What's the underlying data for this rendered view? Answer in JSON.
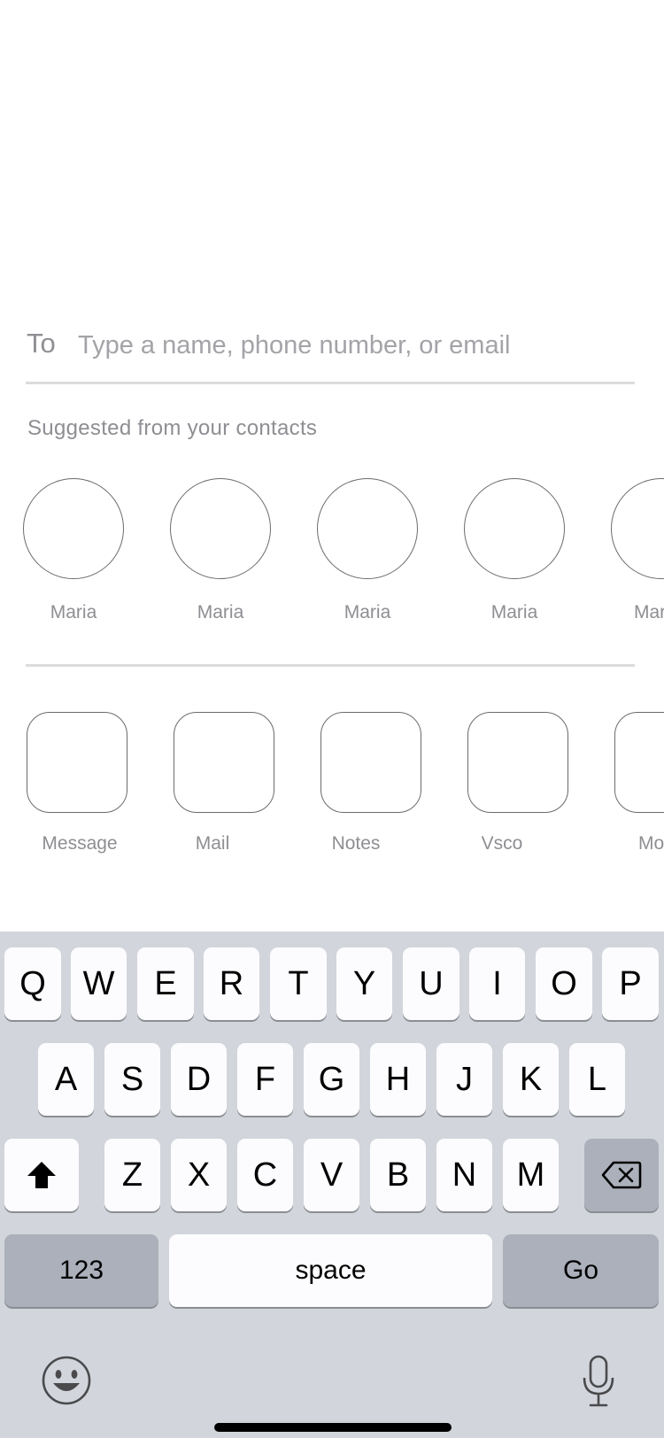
{
  "to_field": {
    "label": "To",
    "placeholder": "Type a name, phone number, or email",
    "value": ""
  },
  "suggestions": {
    "title": "Suggested from your contacts",
    "contacts": [
      {
        "name": "Maria"
      },
      {
        "name": "Maria"
      },
      {
        "name": "Maria"
      },
      {
        "name": "Maria"
      },
      {
        "name": "Mar"
      }
    ]
  },
  "share_apps": [
    {
      "name": "Message"
    },
    {
      "name": "Mail"
    },
    {
      "name": "Notes"
    },
    {
      "name": "Vsco"
    },
    {
      "name": "Mo"
    }
  ],
  "keyboard": {
    "row1": [
      "Q",
      "W",
      "E",
      "R",
      "T",
      "Y",
      "U",
      "I",
      "O",
      "P"
    ],
    "row2": [
      "A",
      "S",
      "D",
      "F",
      "G",
      "H",
      "J",
      "K",
      "L"
    ],
    "row3": [
      "Z",
      "X",
      "C",
      "V",
      "B",
      "N",
      "M"
    ],
    "numbers_label": "123",
    "space_label": "space",
    "go_label": "Go",
    "shift_icon": "shift-arrow-up",
    "delete_icon": "backspace",
    "emoji_icon": "smiley-face",
    "dictation_icon": "microphone"
  }
}
